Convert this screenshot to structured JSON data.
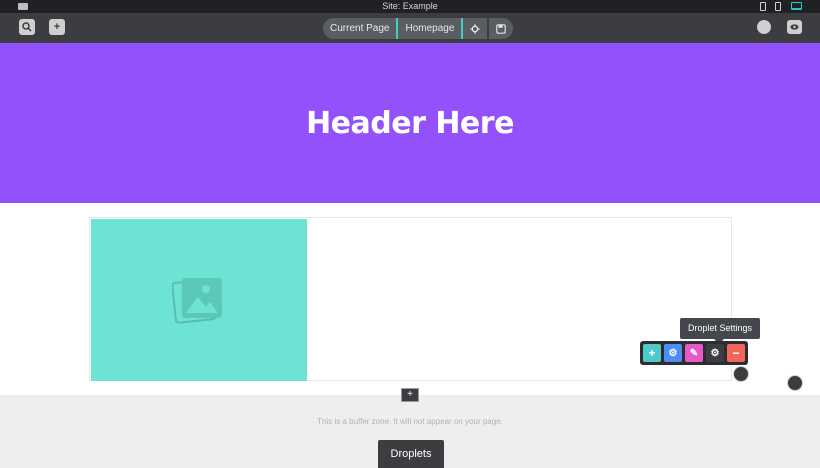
{
  "window": {
    "title": "Site: Example"
  },
  "toolbar": {
    "left_icons": [
      "search-icon",
      "add-page-icon"
    ],
    "current_page_label": "Current Page",
    "page_name": "Homepage",
    "right_icons": [
      "globe-icon",
      "preview-icon"
    ]
  },
  "devices": [
    "tablet-icon",
    "phone-icon",
    "desktop-icon"
  ],
  "canvas": {
    "header_text": "Header Here",
    "header_color": "#9351fc",
    "image_placeholder_color": "#6de3d3",
    "buffer_text": "This is a buffer zone. It will not appear on your page.",
    "droplets_label": "Droplets"
  },
  "droplet_toolbar": {
    "tooltip": "Droplet Settings",
    "buttons": [
      {
        "name": "add-droplet-button",
        "color": "#4fc9c9",
        "glyph": "+"
      },
      {
        "name": "droplet-config-button",
        "color": "#4d8ef4",
        "glyph": "⚙"
      },
      {
        "name": "droplet-style-button",
        "color": "#e659c7",
        "glyph": "✎"
      },
      {
        "name": "droplet-settings-button",
        "color": "#3b3d40",
        "glyph": "⚙"
      },
      {
        "name": "remove-droplet-button",
        "color": "#f0675a",
        "glyph": "−"
      }
    ]
  }
}
